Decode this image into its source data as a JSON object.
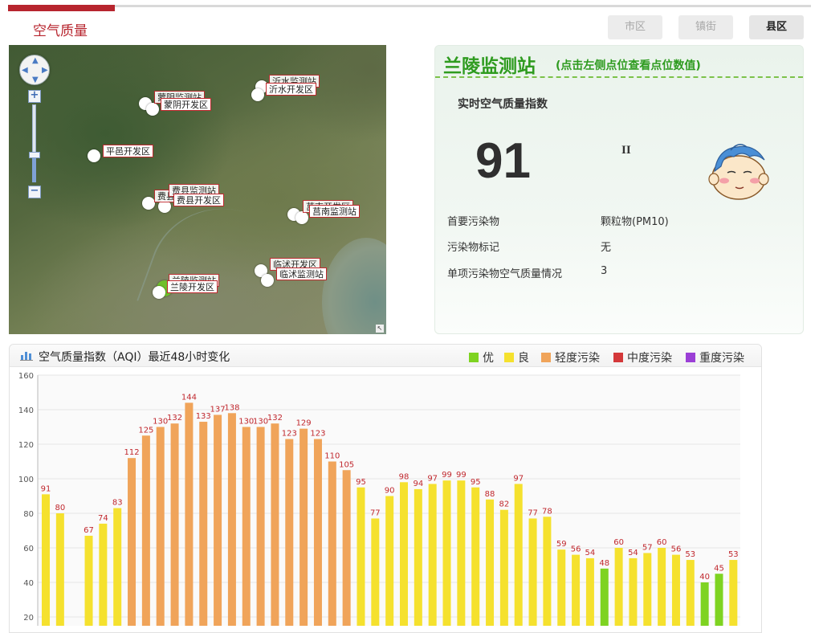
{
  "header": {
    "title": "空气质量"
  },
  "tabs": [
    {
      "label": "市区",
      "active": false
    },
    {
      "label": "镇街",
      "active": false
    },
    {
      "label": "县区",
      "active": true
    }
  ],
  "map": {
    "stations": [
      {
        "name": "蒙阴开发区",
        "ghost": "蒙阴监测站"
      },
      {
        "name": "沂水开发区",
        "ghost": "沂水监测站"
      },
      {
        "name": "平邑开发区",
        "ghost": ""
      },
      {
        "name": "费县开发区",
        "ghost": "费县监测站"
      },
      {
        "name": "莒南监测站",
        "ghost": "莒南开发区"
      },
      {
        "name": "临沭监测站",
        "ghost": "临沭开发区"
      },
      {
        "name": "兰陵开发区",
        "ghost": "兰陵监测站"
      }
    ]
  },
  "station": {
    "name": "兰陵监测站",
    "hint": "(点击左侧点位查看点位数值)",
    "aqi_title": "实时空气质量指数",
    "aqi": "91",
    "level": "II",
    "primary_label": "首要污染物",
    "primary_value": "颗粒物(PM10)",
    "mark_label": "污染物标记",
    "mark_value": "无",
    "single_label": "单项污染物空气质量情况",
    "single_value": "3"
  },
  "chart": {
    "title": "空气质量指数（AQI）最近48小时变化",
    "legend": [
      {
        "label": "优",
        "color": "#7ed321"
      },
      {
        "label": "良",
        "color": "#f5e12e"
      },
      {
        "label": "轻度污染",
        "color": "#f0a45a"
      },
      {
        "label": "中度污染",
        "color": "#d4383a"
      },
      {
        "label": "重度污染",
        "color": "#9b3fd6"
      }
    ]
  },
  "chart_data": {
    "type": "bar",
    "title": "空气质量指数（AQI）最近48小时变化",
    "ylim": [
      0,
      160
    ],
    "yticks": [
      20,
      40,
      60,
      80,
      100,
      120,
      140,
      160
    ],
    "grid": true,
    "legend_position": "top-right",
    "values": [
      91,
      80,
      0,
      67,
      74,
      83,
      112,
      125,
      130,
      132,
      144,
      133,
      137,
      138,
      130,
      130,
      132,
      123,
      129,
      123,
      110,
      105,
      95,
      77,
      90,
      98,
      94,
      97,
      99,
      99,
      95,
      88,
      82,
      97,
      77,
      78,
      59,
      56,
      54,
      48,
      60,
      54,
      57,
      60,
      56,
      53,
      40,
      45,
      53
    ],
    "color_thresholds": [
      {
        "max": 50,
        "color": "#7ed321"
      },
      {
        "max": 100,
        "color": "#f5e12e"
      },
      {
        "max": 150,
        "color": "#f0a45a"
      },
      {
        "max": 200,
        "color": "#d4383a"
      },
      {
        "max": 300,
        "color": "#9b3fd6"
      }
    ]
  }
}
